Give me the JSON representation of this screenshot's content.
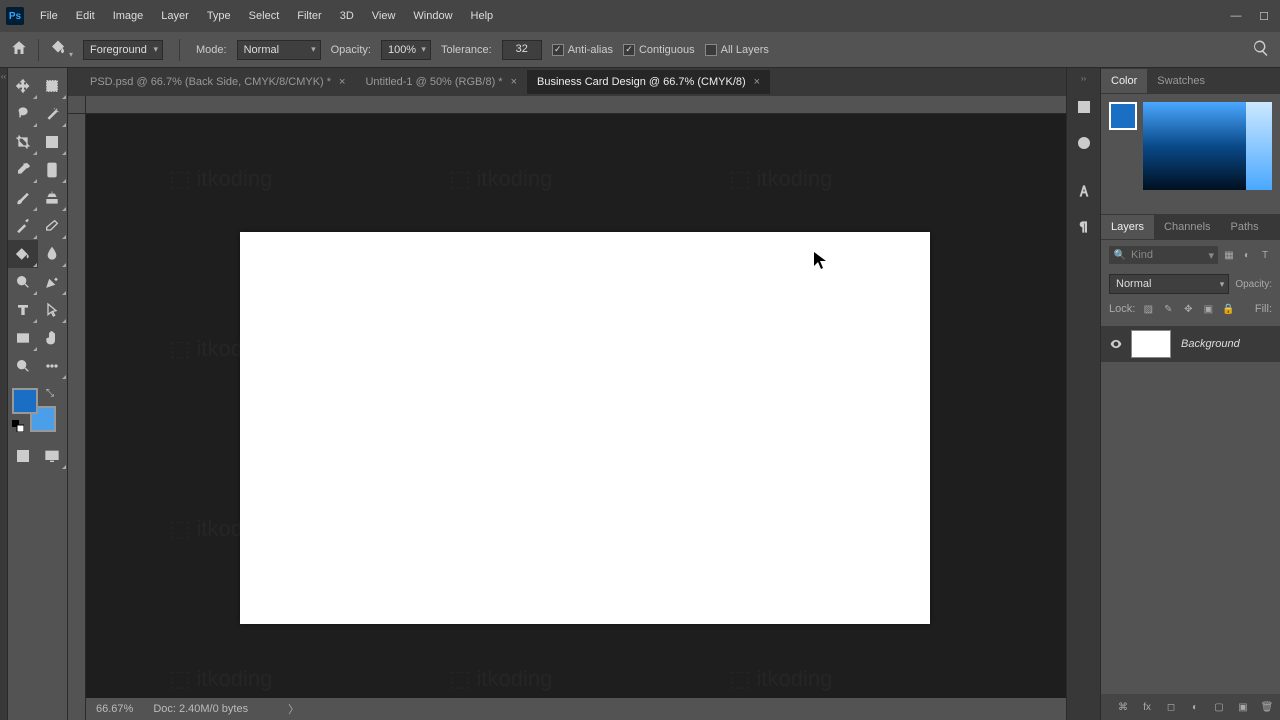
{
  "menubar": {
    "items": [
      "File",
      "Edit",
      "Image",
      "Layer",
      "Type",
      "Select",
      "Filter",
      "3D",
      "View",
      "Window",
      "Help"
    ]
  },
  "optionsbar": {
    "fill_source": "Foreground",
    "mode_label": "Mode:",
    "mode_value": "Normal",
    "opacity_label": "Opacity:",
    "opacity_value": "100%",
    "tolerance_label": "Tolerance:",
    "tolerance_value": "32",
    "antialias": "Anti-alias",
    "contiguous": "Contiguous",
    "all_layers": "All Layers"
  },
  "tabs": [
    {
      "label": "PSD.psd @ 66.7% (Back Side, CMYK/8/CMYK) *"
    },
    {
      "label": "Untitled-1 @ 50% (RGB/8) *"
    },
    {
      "label": "Business Card Design @ 66.7% (CMYK/8)"
    }
  ],
  "statusbar": {
    "zoom": "66.67%",
    "doc_info": "Doc: 2.40M/0 bytes"
  },
  "panels": {
    "color_tab": "Color",
    "swatches_tab": "Swatches",
    "layers_tab": "Layers",
    "channels_tab": "Channels",
    "paths_tab": "Paths",
    "kind_placeholder": "Kind",
    "blend_mode": "Normal",
    "opacity_label": "Opacity:",
    "lock_label": "Lock:",
    "fill_label": "Fill:",
    "layer_name": "Background"
  },
  "colors": {
    "foreground": "#1a6fc4",
    "background": "#4a9fe8"
  }
}
